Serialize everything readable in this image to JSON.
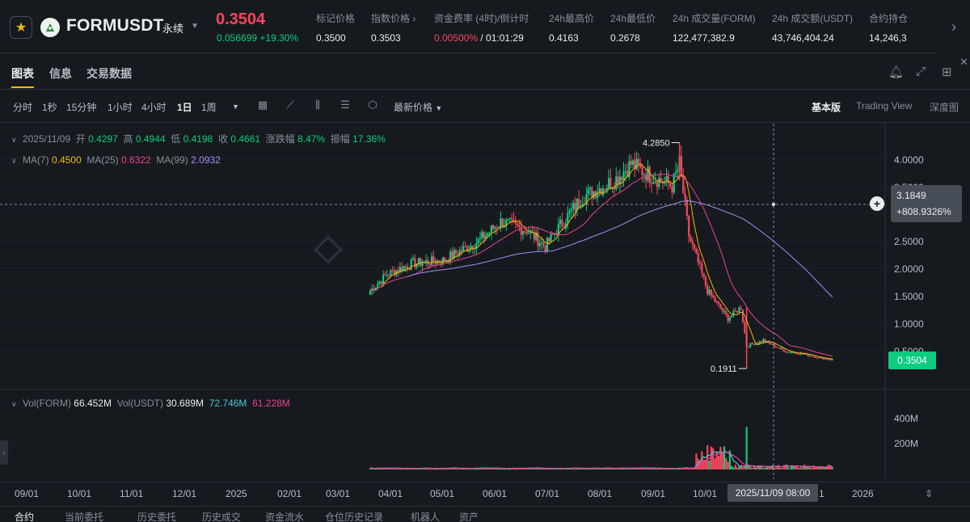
{
  "ticker": {
    "favorite_icon": "star-icon",
    "coin_icon": "form-coin-icon",
    "symbol": "FORMUSDT",
    "contract_type": "永续",
    "last_price": "0.3504",
    "change": "0.056699 +19.30%",
    "stats": [
      {
        "label": "标记价格",
        "value": "0.3500"
      },
      {
        "label": "指数价格 ›",
        "value": "0.3503"
      },
      {
        "label": "资金费率 (4时)/倒计时",
        "value_rate": "0.00500%",
        "value_countdown": " / 01:01:29"
      },
      {
        "label": "24h最高价",
        "value": "0.4163"
      },
      {
        "label": "24h最低价",
        "value": "0.2678"
      },
      {
        "label": "24h 成交量(FORM)",
        "value": "122,477,382.9"
      },
      {
        "label": "24h 成交额(USDT)",
        "value": "43,746,404.24"
      },
      {
        "label": "合约持仓",
        "value": "14,246,3"
      }
    ]
  },
  "tabs": [
    {
      "label": "图表",
      "active": true
    },
    {
      "label": "信息",
      "active": false
    },
    {
      "label": "交易数据",
      "active": false
    }
  ],
  "toolbar": {
    "intervals": [
      "分时",
      "1秒",
      "15分钟",
      "1小时",
      "4小时",
      "1日",
      "1周"
    ],
    "active_interval": "1日",
    "price_type": "最新价格",
    "views": [
      "基本版",
      "Trading View",
      "深度图"
    ],
    "active_view": "基本版"
  },
  "legend": {
    "date": "2025/11/09",
    "open_label": "开",
    "open": "0.4297",
    "high_label": "高",
    "high": "0.4944",
    "low_label": "低",
    "low": "0.4198",
    "close_label": "收",
    "close": "0.4661",
    "chg_label": "涨跌幅",
    "chg": "8.47%",
    "amp_label": "振幅",
    "amp": "17.36%",
    "ma7_label": "MA(7)",
    "ma7": "0.4500",
    "ma25_label": "MA(25)",
    "ma25": "0.6322",
    "ma99_label": "MA(99)",
    "ma99": "2.0932",
    "vol_form_label": "Vol(FORM)",
    "vol_form": "66.452M",
    "vol_usdt_label": "Vol(USDT)",
    "vol_usdt": "30.689M",
    "vol_ma1": "72.746M",
    "vol_ma2": "61.228M"
  },
  "colors": {
    "up": "#0ecb81",
    "down": "#f6465d",
    "ma7": "#f0b90b",
    "ma25": "#e84393",
    "ma99": "#a78bfa",
    "vol_ma1": "#4fc3d6",
    "vol_ma2": "#e84393"
  },
  "crosshair": {
    "price": "3.1849",
    "change": "+808.9326%",
    "time": "2025/11/09 08:00"
  },
  "last_price_tag": "0.3504",
  "annotations": {
    "high": "4.2850",
    "low": "0.1911"
  },
  "price_axis": [
    "4.0000",
    "3.5000",
    "2.5000",
    "2.0000",
    "1.5000",
    "1.0000",
    "0.5000"
  ],
  "volume_axis": [
    "400M",
    "200M"
  ],
  "time_axis": [
    "09/01",
    "10/01",
    "11/01",
    "12/01",
    "2025",
    "02/01",
    "03/01",
    "04/01",
    "05/01",
    "06/01",
    "07/01",
    "08/01",
    "09/01",
    "10/01",
    "1",
    "2026"
  ],
  "chart_data": {
    "type": "candlestick",
    "title": "",
    "x_unit": "days from first candle (2025-03-23)",
    "price_range": [
      0,
      4.5
    ],
    "note_series": "approximate daily closes read off the chart",
    "close_checkpoints": [
      {
        "date": "2025-03-23",
        "close": 1.6
      },
      {
        "date": "2025-04-01",
        "close": 1.9
      },
      {
        "date": "2025-04-15",
        "close": 2.1
      },
      {
        "date": "2025-05-01",
        "close": 2.15
      },
      {
        "date": "2025-05-20",
        "close": 2.5
      },
      {
        "date": "2025-06-01",
        "close": 2.85
      },
      {
        "date": "2025-06-15",
        "close": 2.7
      },
      {
        "date": "2025-06-25",
        "close": 2.4
      },
      {
        "date": "2025-07-01",
        "close": 2.7
      },
      {
        "date": "2025-07-15",
        "close": 3.3
      },
      {
        "date": "2025-08-01",
        "close": 3.6
      },
      {
        "date": "2025-08-10",
        "close": 3.9
      },
      {
        "date": "2025-08-20",
        "close": 3.7
      },
      {
        "date": "2025-09-01",
        "close": 3.5
      },
      {
        "date": "2025-09-05",
        "close": 3.9
      },
      {
        "date": "2025-09-10",
        "close": 2.6
      },
      {
        "date": "2025-09-20",
        "close": 1.6
      },
      {
        "date": "2025-10-01",
        "close": 1.1
      },
      {
        "date": "2025-10-08",
        "close": 1.3
      },
      {
        "date": "2025-10-11",
        "close": 0.6
      },
      {
        "date": "2025-10-20",
        "close": 0.7
      },
      {
        "date": "2025-11-01",
        "close": 0.5
      },
      {
        "date": "2025-11-09",
        "close": 0.466
      },
      {
        "date": "2025-11-20",
        "close": 0.38
      },
      {
        "date": "2025-11-27",
        "close": 0.3504
      }
    ]
  },
  "bottom_tabs": [
    "合约",
    "当前委托",
    "历史委托",
    "历史成交",
    "资金流水",
    "仓位历史记录",
    "机器人",
    "资产"
  ]
}
